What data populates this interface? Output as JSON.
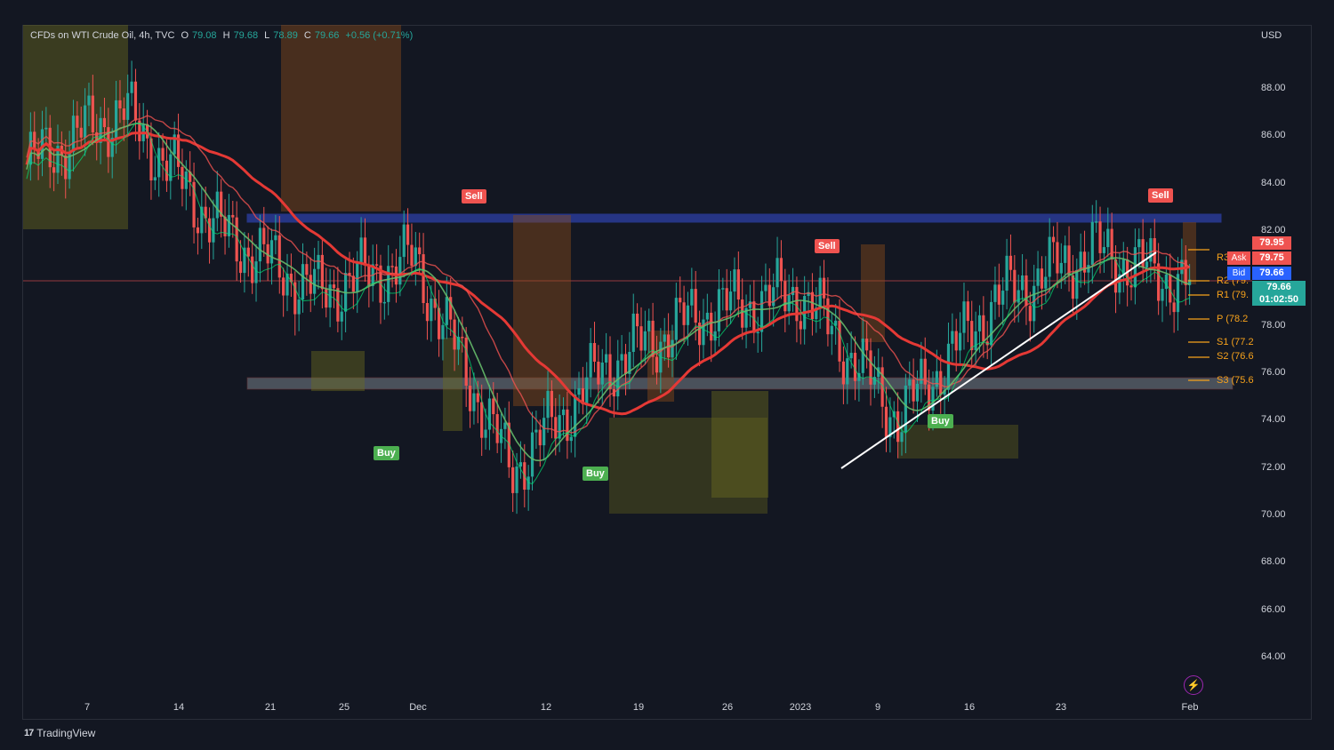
{
  "legend": {
    "symbol": "CFDs on WTI Crude Oil, 4h, TVC",
    "o_label": "O",
    "o_value": "79.08",
    "h_label": "H",
    "h_value": "79.68",
    "l_label": "L",
    "l_value": "78.89",
    "c_label": "C",
    "c_value": "79.66",
    "change": "+0.56 (+0.71%)"
  },
  "currency": "USD",
  "y_axis": [
    "88.00",
    "86.00",
    "84.00",
    "82.00",
    "80.00",
    "78.00",
    "76.00",
    "74.00",
    "72.00",
    "70.00",
    "68.00",
    "66.00",
    "64.00"
  ],
  "x_axis": [
    "7",
    "14",
    "21",
    "25",
    "Dec",
    "12",
    "19",
    "26",
    "2023",
    "9",
    "16",
    "23",
    "Feb"
  ],
  "signals": {
    "sell": "Sell",
    "buy": "Buy"
  },
  "pivots": [
    "R3",
    "R2 (79.",
    "R1 (79.",
    "P (78.2",
    "S1 (77.2",
    "S2 (76.6",
    "S3 (75.6"
  ],
  "quote": {
    "ask_label": "Ask",
    "ask_value": "79.75",
    "bid_label": "Bid",
    "bid_value": "79.66",
    "high_value": "79.95",
    "last_value": "79.66",
    "countdown": "01:02:50"
  },
  "footer": {
    "brand": "TradingView",
    "mark": "17"
  },
  "colors": {
    "bg": "#131722",
    "up": "#26a69a",
    "down": "#ef5350",
    "sell": "#ef5350",
    "buy": "#4caf50",
    "pivot": "#f7a21b",
    "bid": "#2962ff"
  },
  "chart_data": {
    "type": "line",
    "title": "CFDs on WTI Crude Oil, 4h, TVC",
    "ylim": [
      63,
      90
    ],
    "x": [
      "7",
      "14",
      "21",
      "25",
      "Dec",
      "12",
      "19",
      "26",
      "2023",
      "9",
      "16",
      "23",
      "Feb"
    ],
    "series": [
      {
        "values": [
          84.8,
          87.1,
          82.0,
          79.4,
          80.8,
          71.9,
          76.4,
          78.6,
          79.4,
          74.1,
          79.1,
          81.2,
          79.7
        ]
      }
    ]
  }
}
